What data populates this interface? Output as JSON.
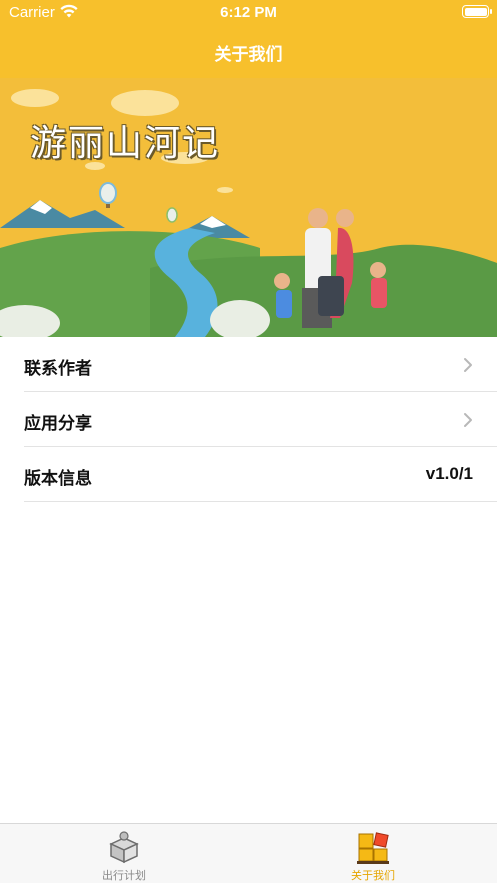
{
  "status_bar": {
    "carrier": "Carrier",
    "time": "6:12 PM"
  },
  "nav": {
    "title": "关于我们"
  },
  "banner": {
    "title": "游丽山河记"
  },
  "menu": {
    "items": [
      {
        "label": "联系作者",
        "icon": "chevron-right-icon"
      },
      {
        "label": "应用分享",
        "icon": "chevron-right-icon"
      },
      {
        "label": "版本信息",
        "value": "v1.0/1"
      }
    ]
  },
  "tabbar": {
    "tabs": [
      {
        "label": "出行计划",
        "icon": "package-box-icon",
        "selected": false
      },
      {
        "label": "关于我们",
        "icon": "blocks-icon",
        "selected": true
      }
    ]
  },
  "colors": {
    "accent": "#F7C02C",
    "tab_selected": "#E5A500",
    "tab_unselected": "#8a8a8a"
  }
}
